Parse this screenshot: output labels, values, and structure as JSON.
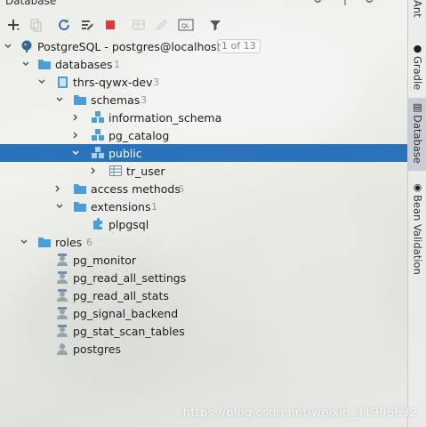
{
  "window": {
    "title": "Database"
  },
  "tree": {
    "connection": {
      "label": "PostgreSQL - postgres@localhost",
      "badge": "1 of 13"
    },
    "databases": {
      "label": "databases",
      "count": "1"
    },
    "database": {
      "label": "thrs-qywx-dev",
      "count": "3"
    },
    "schemas": {
      "label": "schemas",
      "count": "3"
    },
    "schema_items": [
      {
        "label": "information_schema"
      },
      {
        "label": "pg_catalog"
      },
      {
        "label": "public"
      }
    ],
    "table": {
      "label": "tr_user"
    },
    "access_methods": {
      "label": "access methods",
      "count": "6"
    },
    "extensions": {
      "label": "extensions",
      "count": "1"
    },
    "extension_item": {
      "label": "plpgsql"
    },
    "roles": {
      "label": "roles",
      "count": "6"
    },
    "role_items": [
      {
        "label": "pg_monitor"
      },
      {
        "label": "pg_read_all_settings"
      },
      {
        "label": "pg_read_all_stats"
      },
      {
        "label": "pg_signal_backend"
      },
      {
        "label": "pg_stat_scan_tables"
      },
      {
        "label": "postgres"
      }
    ]
  },
  "right_tabs": [
    {
      "label": "Ant"
    },
    {
      "label": "Gradle"
    },
    {
      "label": "Database"
    },
    {
      "label": "Bean Validation"
    }
  ],
  "watermark": "https://blog.csdn.net/weixin_41996632",
  "colors": {
    "selection": "#2a72b9",
    "folder": "#4a9fd8",
    "stop": "#e0383b"
  }
}
